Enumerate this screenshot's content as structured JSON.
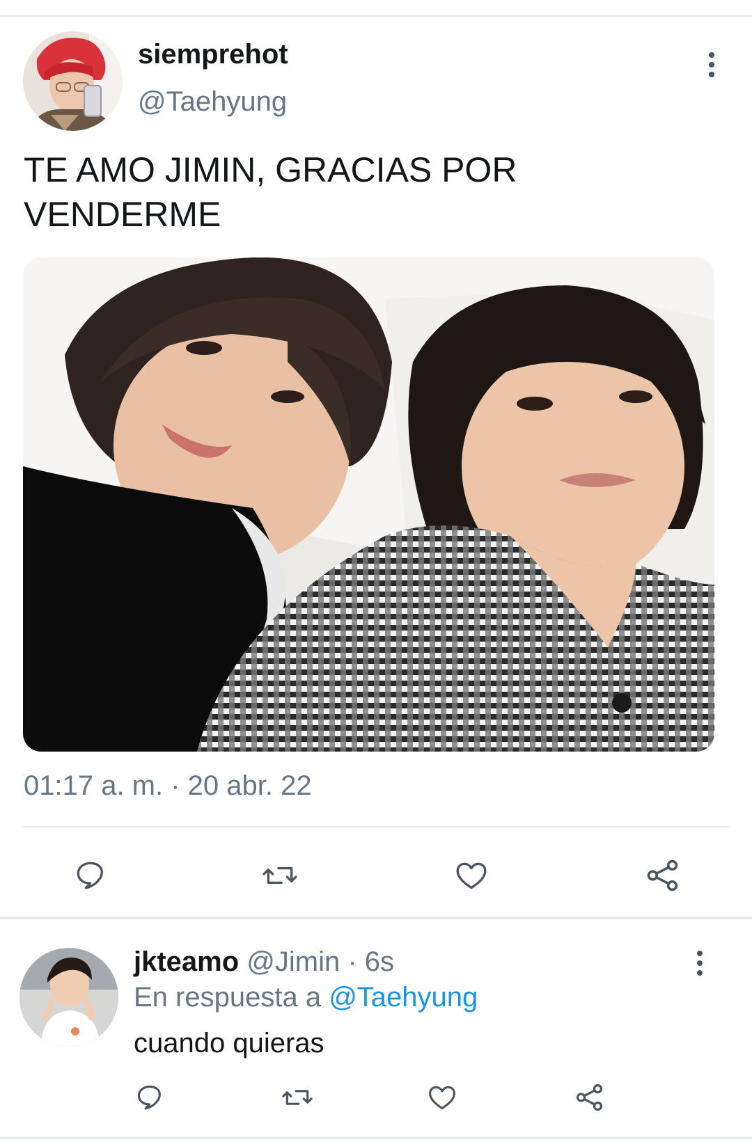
{
  "tweet": {
    "display_name": "siemprehot",
    "handle": "@Taehyung",
    "text": "TE AMO JIMIN, GRACIAS POR\nVENDERME",
    "timestamp": "01:17 a. m. · 20 abr. 22",
    "actions": [
      "reply-icon",
      "retweet-icon",
      "like-icon",
      "share-icon"
    ]
  },
  "reply": {
    "display_name": "jkteamo",
    "meta": "@Jimin · 6s",
    "in_reply_prefix": "En respuesta a ",
    "in_reply_handle": "@Taehyung",
    "text": "cuando quieras",
    "actions": [
      "reply-icon",
      "retweet-icon",
      "like-icon",
      "share-icon"
    ]
  },
  "colors": {
    "text": "#14171a",
    "secondary": "#657786",
    "link": "#1b95e0",
    "icon": "#4a5560",
    "divider": "#e6ecf0"
  }
}
